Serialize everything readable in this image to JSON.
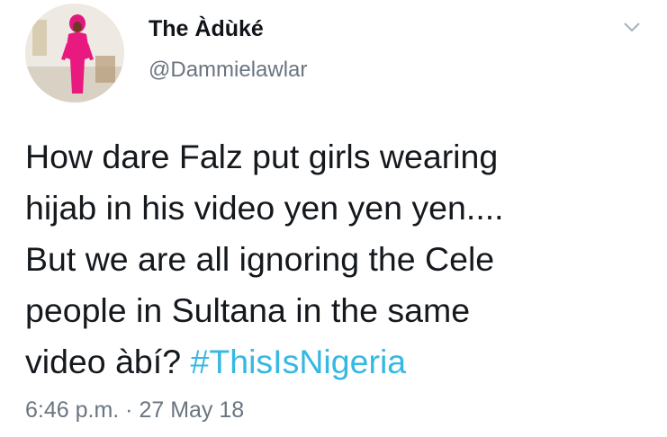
{
  "tweet": {
    "display_name": "The Àdùké",
    "handle": "@Dammielawlar",
    "text_lines": [
      "How dare Falz put girls wearing",
      "hijab in his video yen yen yen....",
      "But we are all ignoring the Cele",
      "people in Sultana in the same",
      "video àbí? "
    ],
    "hashtag": "#ThisIsNigeria",
    "timestamp": "6:46 p.m. · 27 May 18"
  },
  "icons": {
    "menu": "chevron-down-icon",
    "avatar": "profile-photo"
  },
  "colors": {
    "hashtag": "#35b8e2",
    "secondary_text": "#6b7580",
    "primary_text": "#15191d"
  }
}
